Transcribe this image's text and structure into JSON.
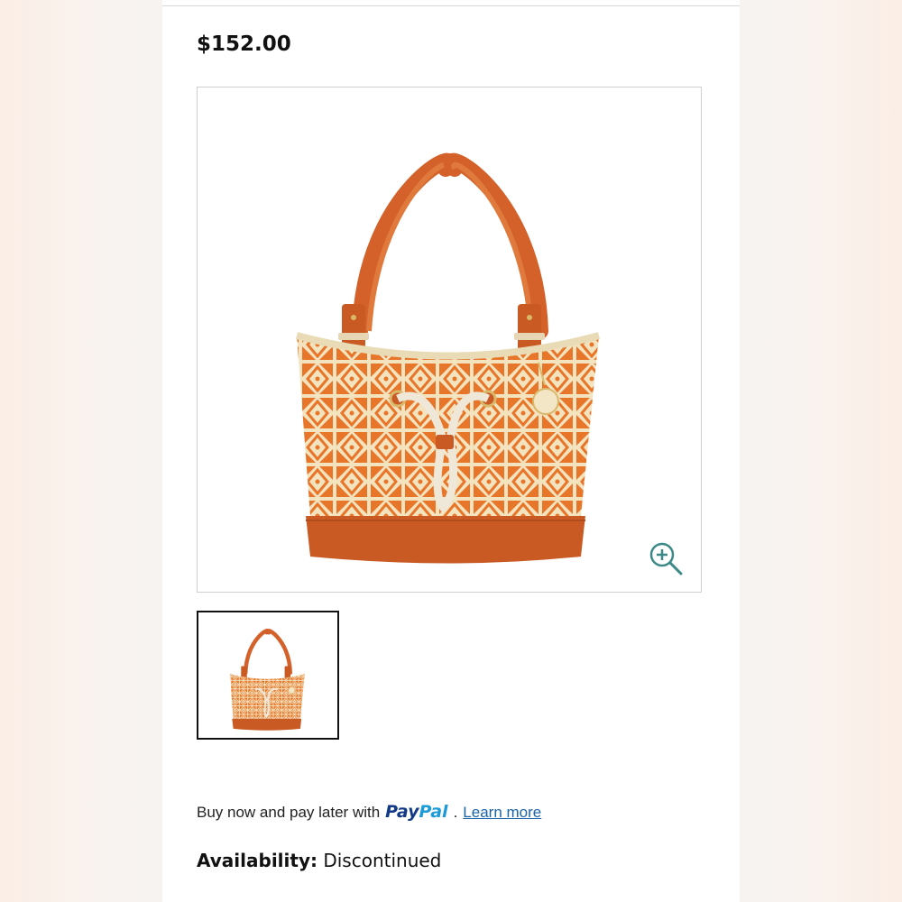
{
  "product": {
    "price": "$152.00",
    "main_image_icon": "orange-geometric-tote-bag",
    "zoom_icon": "zoom-in-icon",
    "thumbnails": [
      {
        "icon": "orange-geometric-tote-bag-thumbnail",
        "selected": true
      }
    ]
  },
  "payment": {
    "prefix": "Buy now and pay later with",
    "brand_pay": "Pay",
    "brand_pal": "Pal",
    "separator": ".",
    "link": "Learn more"
  },
  "availability": {
    "label": "Availability:",
    "value": "Discontinued"
  },
  "colors": {
    "bag_orange": "#e8762a",
    "bag_cream": "#f3e3bf",
    "leather": "#c95a23",
    "paypal_dark": "#123985",
    "paypal_light": "#1d9bd7",
    "link": "#1a63a8"
  }
}
